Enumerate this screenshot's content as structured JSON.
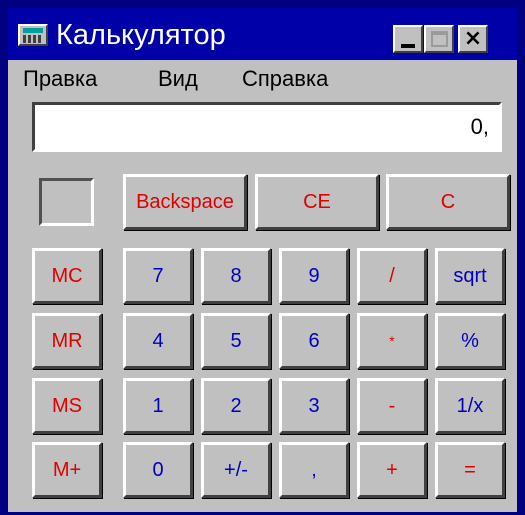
{
  "window": {
    "title": "Калькулятор"
  },
  "titlebar": {
    "minimize_icon": "minimize-icon",
    "maximize_icon": "maximize-icon",
    "close_label": "×"
  },
  "menu": [
    "Правка",
    "Вид",
    "Справка"
  ],
  "display": {
    "value": "0,"
  },
  "top_row": {
    "backspace": "Backspace",
    "ce": "CE",
    "c": "C"
  },
  "memory": {
    "mc": "MC",
    "mr": "MR",
    "ms": "MS",
    "mplus": "M+"
  },
  "keys": {
    "seven": "7",
    "eight": "8",
    "nine": "9",
    "divide": "/",
    "sqrt": "sqrt",
    "four": "4",
    "five": "5",
    "six": "6",
    "multiply": "*",
    "percent": "%",
    "one": "1",
    "two": "2",
    "three": "3",
    "minus": "-",
    "reciprocal": "1/x",
    "zero": "0",
    "plusminus": "+/-",
    "comma": ",",
    "plus": "+",
    "equals": "="
  },
  "colors": {
    "desktop": "#000080",
    "titlebar": "#0000a8",
    "face": "#c0c0c0",
    "red_text": "#e00000",
    "blue_text": "#0000c0"
  }
}
